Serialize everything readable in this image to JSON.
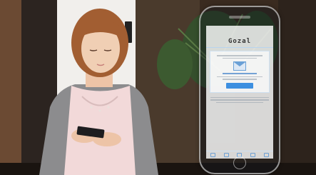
{
  "phone": {
    "status_time": "",
    "nav_back": "",
    "app_logo": "Gozal",
    "card_title": "",
    "button_label": ""
  }
}
